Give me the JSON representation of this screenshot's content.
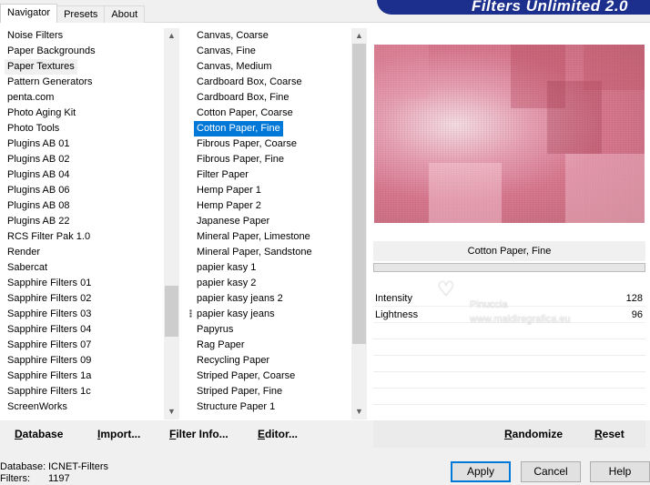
{
  "app": {
    "title": "Filters Unlimited 2.0"
  },
  "tabs": [
    {
      "label": "Navigator",
      "active": true
    },
    {
      "label": "Presets",
      "active": false
    },
    {
      "label": "About",
      "active": false
    }
  ],
  "categories": {
    "items": [
      "Noise Filters",
      "Paper Backgrounds",
      "Paper Textures",
      "Pattern Generators",
      "penta.com",
      "Photo Aging Kit",
      "Photo Tools",
      "Plugins AB 01",
      "Plugins AB 02",
      "Plugins AB 04",
      "Plugins AB 06",
      "Plugins AB 08",
      "Plugins AB 22",
      "RCS Filter Pak 1.0",
      "Render",
      "Sabercat",
      "Sapphire Filters 01",
      "Sapphire Filters 02",
      "Sapphire Filters 03",
      "Sapphire Filters 04",
      "Sapphire Filters 07",
      "Sapphire Filters 09",
      "Sapphire Filters 1a",
      "Sapphire Filters 1c",
      "ScreenWorks"
    ],
    "selected_index": 2
  },
  "filters": {
    "items": [
      "Canvas, Coarse",
      "Canvas, Fine",
      "Canvas, Medium",
      "Cardboard Box, Coarse",
      "Cardboard Box, Fine",
      "Cotton Paper, Coarse",
      "Cotton Paper, Fine",
      "Fibrous Paper, Coarse",
      "Fibrous Paper, Fine",
      "Filter Paper",
      "Hemp Paper 1",
      "Hemp Paper 2",
      "Japanese Paper",
      "Mineral Paper, Limestone",
      "Mineral Paper, Sandstone",
      "papier kasy 1",
      "papier kasy 2",
      "papier kasy jeans 2",
      "papier kasy jeans",
      "Papyrus",
      "Rag Paper",
      "Recycling Paper",
      "Striped Paper, Coarse",
      "Striped Paper, Fine",
      "Structure Paper 1"
    ],
    "selected_index": 6
  },
  "preview": {
    "filter_name": "Cotton Paper, Fine"
  },
  "params": [
    {
      "label": "Intensity",
      "value": "128"
    },
    {
      "label": "Lightness",
      "value": "96"
    }
  ],
  "watermark": {
    "line1": "Pinuccia",
    "line2": "www.maldiregrafica.eu"
  },
  "buttons": {
    "database": "Database",
    "import": "Import...",
    "filter_info": "Filter Info...",
    "editor": "Editor...",
    "randomize": "Randomize",
    "reset": "Reset",
    "apply": "Apply",
    "cancel": "Cancel",
    "help": "Help"
  },
  "status": {
    "database_label": "Database:",
    "database_value": "ICNET-Filters",
    "filters_label": "Filters:",
    "filters_value": "1197"
  },
  "icons": {
    "scroll_up": "chevron-up-icon",
    "scroll_down": "chevron-down-icon"
  }
}
